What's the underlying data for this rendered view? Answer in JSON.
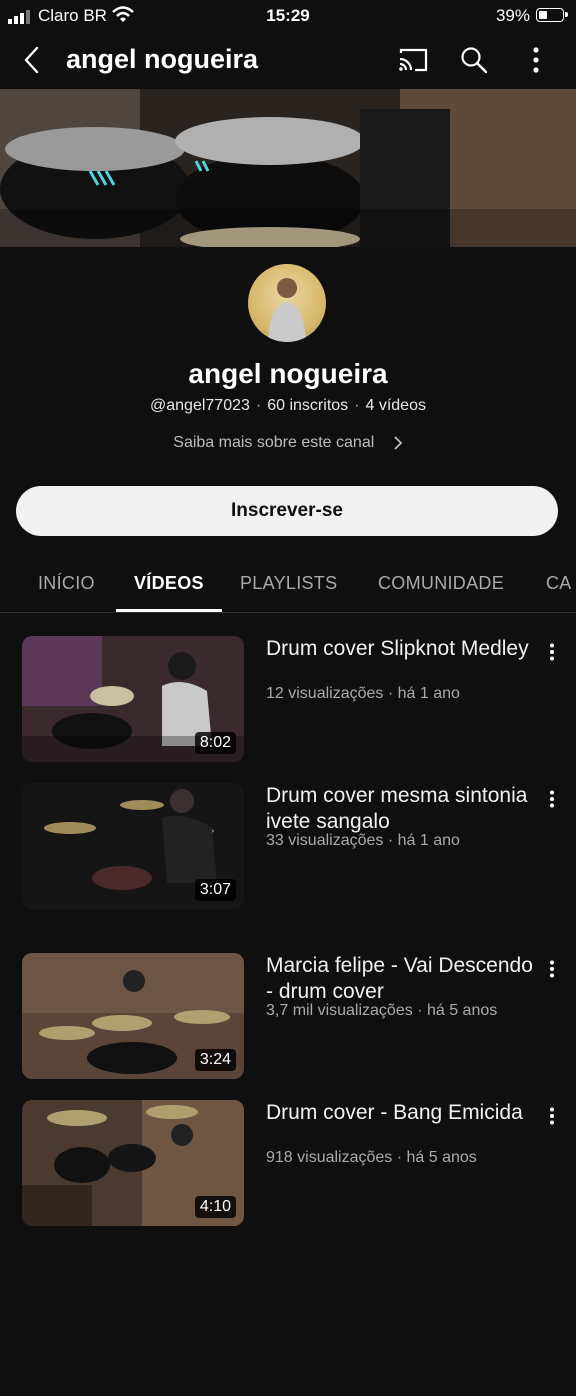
{
  "status_bar": {
    "carrier": "Claro BR",
    "time": "15:29",
    "battery": "39%",
    "battery_level": 0.39
  },
  "app_bar": {
    "title": "angel nogueira",
    "icons": [
      "back-icon",
      "cast-icon",
      "search-icon",
      "more-vert-icon"
    ]
  },
  "channel": {
    "name": "angel nogueira",
    "handle": "@angel77023",
    "subscribers": "60 inscritos",
    "videos_count": "4 vídeos",
    "about_link": "Saiba mais sobre este canal",
    "subscribe_label": "Inscrever-se"
  },
  "tabs": [
    {
      "label": "INÍCIO"
    },
    {
      "label": "VÍDEOS"
    },
    {
      "label": "PLAYLISTS"
    },
    {
      "label": "COMUNIDADE"
    },
    {
      "label": "CA"
    }
  ],
  "active_tab": "VÍDEOS",
  "videos": [
    {
      "title": "Drum cover   Slipknot Medley",
      "views": "12 visualizações",
      "age": "há 1 ano",
      "duration": "8:02"
    },
    {
      "title": "Drum cover   mesma sintonia  ivete sangalo",
      "views": "33 visualizações",
      "age": "há 1 ano",
      "duration": "3:07"
    },
    {
      "title": "Marcia felipe - Vai Descendo - drum cover",
      "views": "3,7 mil visualizações",
      "age": "há 5 anos",
      "duration": "3:24"
    },
    {
      "title": "Drum cover - Bang Emicida",
      "views": "918 visualizações",
      "age": "há 5 anos",
      "duration": "4:10"
    }
  ],
  "colors": {
    "background": "#0f0f0f",
    "subscribe_bg": "#f1f1f1",
    "muted_text": "#aaaaaa"
  }
}
